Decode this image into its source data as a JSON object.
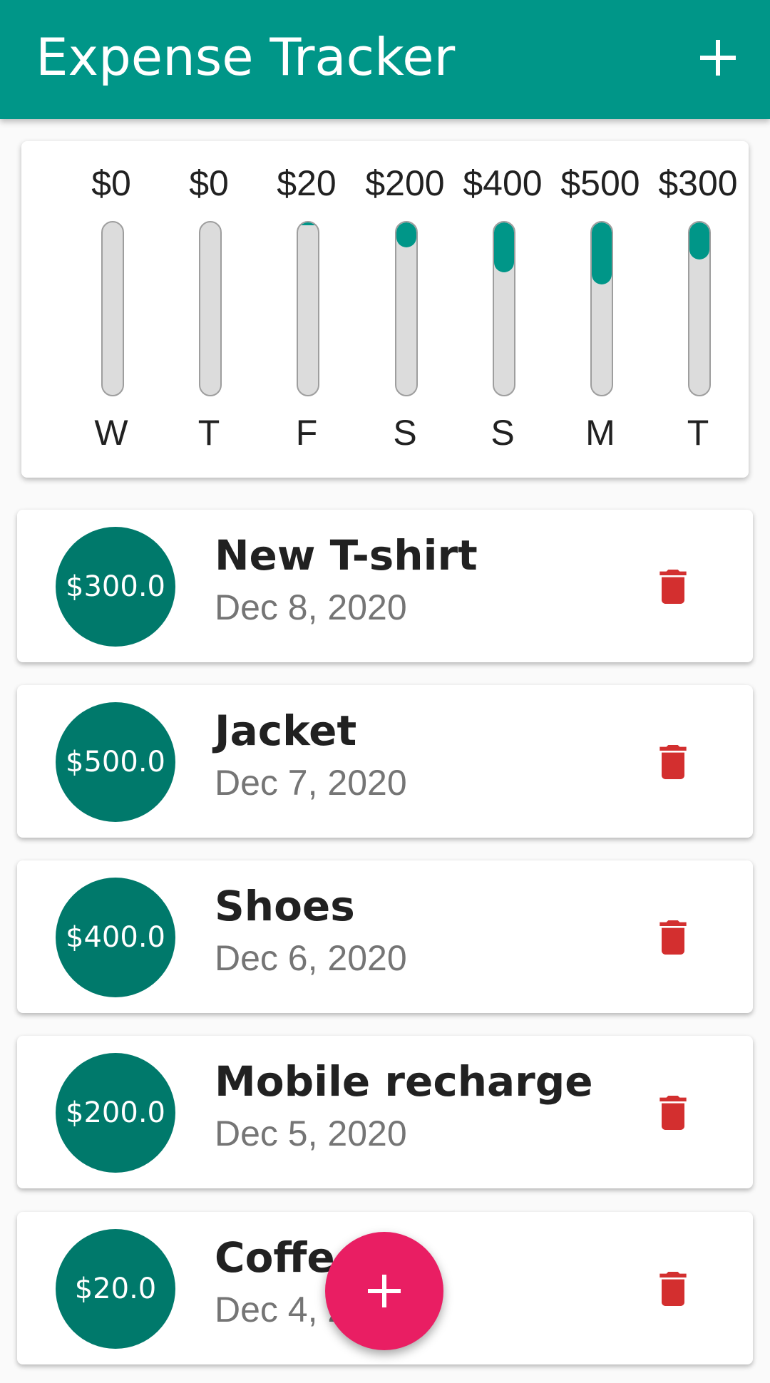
{
  "app_bar": {
    "title": "Expense Tracker",
    "add_icon": "plus-icon",
    "color": "#009688"
  },
  "chart": {
    "max_value": 500,
    "fill_color": "#009688",
    "bars": [
      {
        "day": "W",
        "amount_label": "$0",
        "value": 0
      },
      {
        "day": "T",
        "amount_label": "$0",
        "value": 0
      },
      {
        "day": "F",
        "amount_label": "$20",
        "value": 20
      },
      {
        "day": "S",
        "amount_label": "$200",
        "value": 200
      },
      {
        "day": "S",
        "amount_label": "$400",
        "value": 400
      },
      {
        "day": "M",
        "amount_label": "$500",
        "value": 500
      },
      {
        "day": "T",
        "amount_label": "$300",
        "value": 300
      }
    ]
  },
  "transactions": [
    {
      "amount": "$300.0",
      "title": "New T-shirt",
      "date": "Dec 8, 2020",
      "delete_icon": "trash-icon"
    },
    {
      "amount": "$500.0",
      "title": "Jacket",
      "date": "Dec 7, 2020",
      "delete_icon": "trash-icon"
    },
    {
      "amount": "$400.0",
      "title": "Shoes",
      "date": "Dec 6, 2020",
      "delete_icon": "trash-icon"
    },
    {
      "amount": "$200.0",
      "title": "Mobile recharge",
      "date": "Dec 5, 2020",
      "delete_icon": "trash-icon"
    },
    {
      "amount": "$20.0",
      "title": "Coffee",
      "date": "Dec 4, 2020",
      "delete_icon": "trash-icon"
    }
  ],
  "fab": {
    "icon": "plus-icon",
    "color": "#e91e63"
  },
  "colors": {
    "avatar": "#00796b",
    "delete": "#d32f2f"
  }
}
